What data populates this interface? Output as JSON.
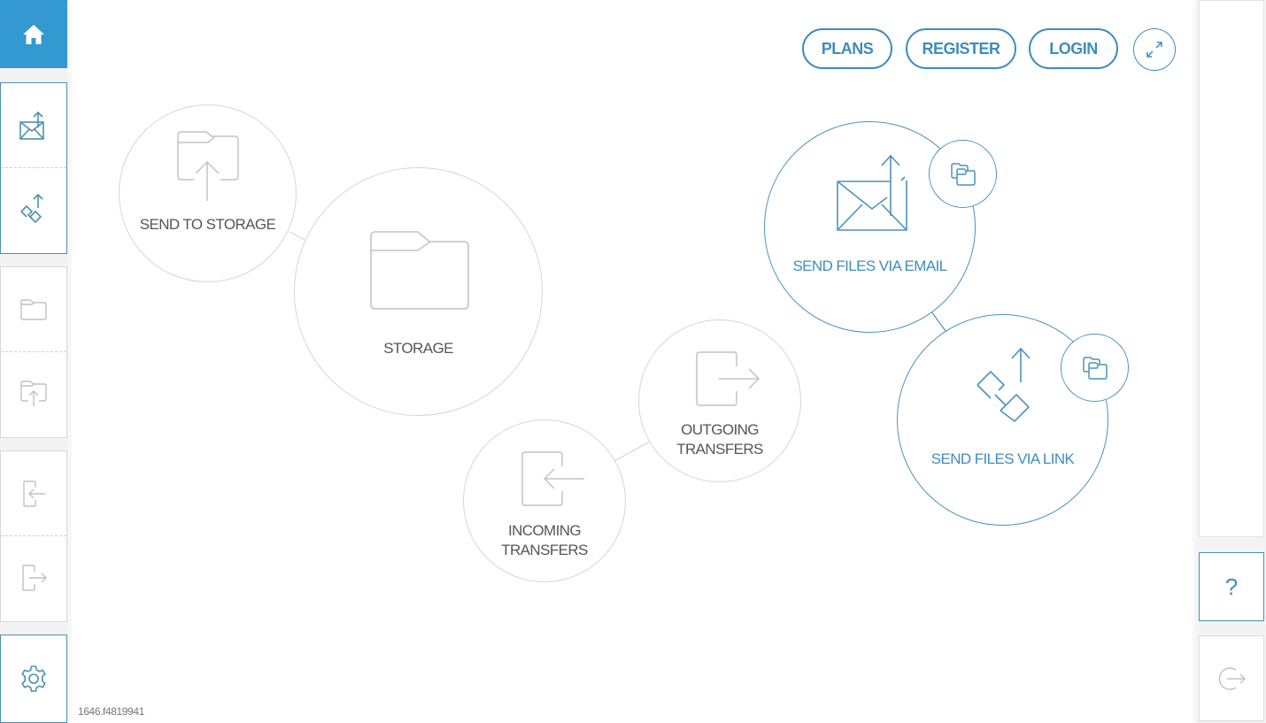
{
  "sidebar": {
    "home": {
      "icon": "home-icon",
      "label": "Home"
    },
    "items": [
      {
        "icon": "send-email-icon",
        "label": "Send files via email",
        "group": 1
      },
      {
        "icon": "send-link-icon",
        "label": "Send files via link",
        "group": 1
      },
      {
        "icon": "folder-icon",
        "label": "Storage",
        "group": 2
      },
      {
        "icon": "folder-upload-icon",
        "label": "Send to storage",
        "group": 2
      },
      {
        "icon": "incoming-icon",
        "label": "Incoming transfers",
        "group": 3
      },
      {
        "icon": "outgoing-icon",
        "label": "Outgoing transfers",
        "group": 3
      },
      {
        "icon": "gear-icon",
        "label": "Settings",
        "group": 4
      }
    ]
  },
  "header": {
    "plans_label": "PLANS",
    "register_label": "REGISTER",
    "login_label": "LOGIN",
    "expand_icon": "expand-icon"
  },
  "bubbles": {
    "send_to_storage": {
      "label": "SEND TO STORAGE"
    },
    "storage": {
      "label": "STORAGE"
    },
    "outgoing": {
      "line1": "OUTGOING",
      "line2": "TRANSFERS"
    },
    "incoming": {
      "line1": "INCOMING",
      "line2": "TRANSFERS"
    },
    "email": {
      "label": "SEND FILES VIA EMAIL"
    },
    "link": {
      "label": "SEND FILES VIA LINK"
    }
  },
  "right_sidebar": {
    "help_label": "?",
    "logout_icon": "logout-icon"
  },
  "footer": {
    "version": "1646.f4819941"
  },
  "colors": {
    "accent": "#3399d0",
    "accent_dark": "#3d8dbd",
    "inactive": "#bdbdbd"
  }
}
